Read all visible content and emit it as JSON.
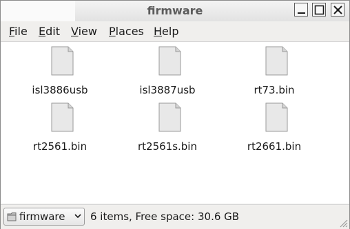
{
  "window": {
    "title": "firmware"
  },
  "menu": [
    "File",
    "Edit",
    "View",
    "Places",
    "Help"
  ],
  "files": [
    {
      "name": "isl3886usb"
    },
    {
      "name": "isl3887usb"
    },
    {
      "name": "rt73.bin"
    },
    {
      "name": "rt2561.bin"
    },
    {
      "name": "rt2561s.bin"
    },
    {
      "name": "rt2661.bin"
    }
  ],
  "statusbar": {
    "location": "firmware",
    "info": "6 items, Free space: 30.6 GB"
  },
  "icons": {
    "file": "generic-file-icon",
    "folder": "folder-icon"
  }
}
